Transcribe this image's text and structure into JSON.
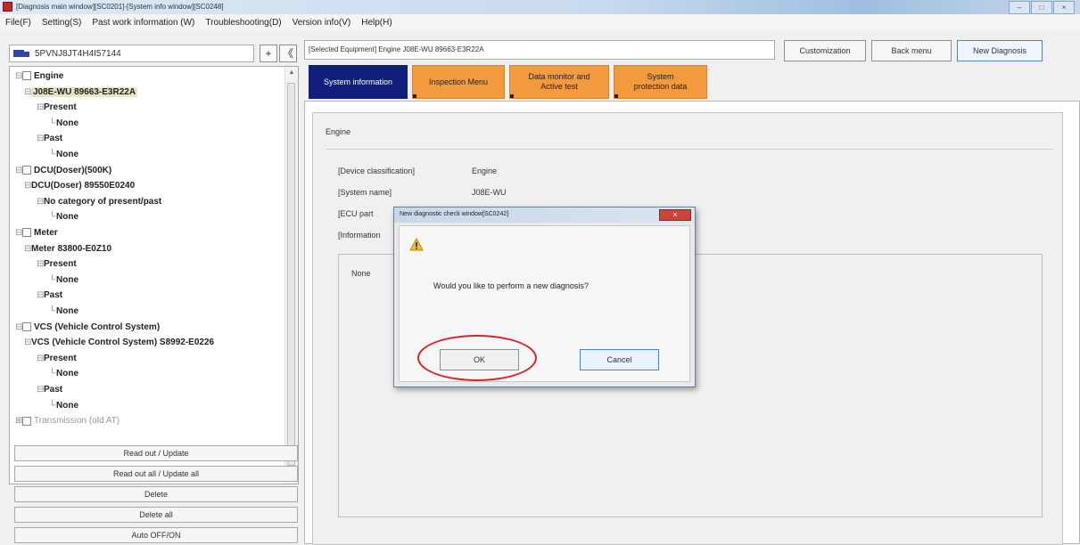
{
  "window": {
    "title": "[Diagnosis main window][SC0201]-[System info window][SC0248]",
    "controls": [
      "–",
      "□",
      "×"
    ]
  },
  "menu": [
    "File(F)",
    "Setting(S)",
    "Past work information (W)",
    "Troubleshooting(D)",
    "Version info(V)",
    "Help(H)"
  ],
  "left": {
    "vin": "5PVNJ8JT4H4I57144",
    "plus_label": "+",
    "collapse_label": "《",
    "tree": [
      {
        "text": "Engine",
        "level": 0,
        "checkbox": true,
        "expander": "⊟"
      },
      {
        "text": "J08E-WU 89663-E3R22A",
        "level": 1,
        "expander": "⊟",
        "selected": true
      },
      {
        "text": "Present",
        "level": 2,
        "expander": "⊟"
      },
      {
        "text": "None",
        "level": 3
      },
      {
        "text": "Past",
        "level": 2,
        "expander": "⊟"
      },
      {
        "text": "None",
        "level": 3
      },
      {
        "text": "DCU(Doser)(500K)",
        "level": 0,
        "checkbox": true,
        "expander": "⊟"
      },
      {
        "text": "DCU(Doser) 89550E0240",
        "level": 1,
        "expander": "⊟"
      },
      {
        "text": "No category of present/past",
        "level": 2,
        "expander": "⊟"
      },
      {
        "text": "None",
        "level": 3
      },
      {
        "text": "Meter",
        "level": 0,
        "checkbox": true,
        "expander": "⊟"
      },
      {
        "text": "Meter 83800-E0Z10",
        "level": 1,
        "expander": "⊟"
      },
      {
        "text": "Present",
        "level": 2,
        "expander": "⊟"
      },
      {
        "text": "None",
        "level": 3
      },
      {
        "text": "Past",
        "level": 2,
        "expander": "⊟"
      },
      {
        "text": "None",
        "level": 3
      },
      {
        "text": "VCS (Vehicle Control System)",
        "level": 0,
        "checkbox": true,
        "expander": "⊟"
      },
      {
        "text": "VCS (Vehicle Control System) S8992-E0226",
        "level": 1,
        "expander": "⊟"
      },
      {
        "text": "Present",
        "level": 2,
        "expander": "⊟"
      },
      {
        "text": "None",
        "level": 3
      },
      {
        "text": "Past",
        "level": 2,
        "expander": "⊟"
      },
      {
        "text": "None",
        "level": 3
      },
      {
        "text": "Transmission (old AT)",
        "level": 0,
        "checkbox": true,
        "expander": "⊞",
        "muted": true
      }
    ],
    "actions": [
      "Read out / Update",
      "Read out all / Update all",
      "Delete",
      "Delete all",
      "Auto OFF/ON"
    ]
  },
  "right": {
    "selected_equipment": "[Selected Equipment] Engine J08E-WU 89663-E3R22A",
    "buttons": {
      "customization": "Customization",
      "back_menu": "Back menu",
      "new_diagnosis": "New Diagnosis"
    },
    "tabs": [
      {
        "label": "System information"
      },
      {
        "label": "Inspection Menu"
      },
      {
        "label": "Data monitor and Active test"
      },
      {
        "label": "System protection data"
      }
    ],
    "section": "Engine",
    "info": [
      {
        "label": "[Device classification]",
        "value": "Engine"
      },
      {
        "label": "[System name]",
        "value": "J08E-WU"
      },
      {
        "label": "[ECU part",
        "value": ""
      },
      {
        "label": "[Information",
        "value": ""
      }
    ],
    "none_text": "None"
  },
  "dialog": {
    "title": "New diagnostic check window[SC0242]",
    "close_label": "×",
    "message": "Would you like to perform a new diagnosis?",
    "ok_label": "OK",
    "cancel_label": "Cancel"
  },
  "colors": {
    "tab_active": "#0f1e78",
    "tab_inactive": "#f49a3e",
    "highlight": "#d7262b"
  }
}
